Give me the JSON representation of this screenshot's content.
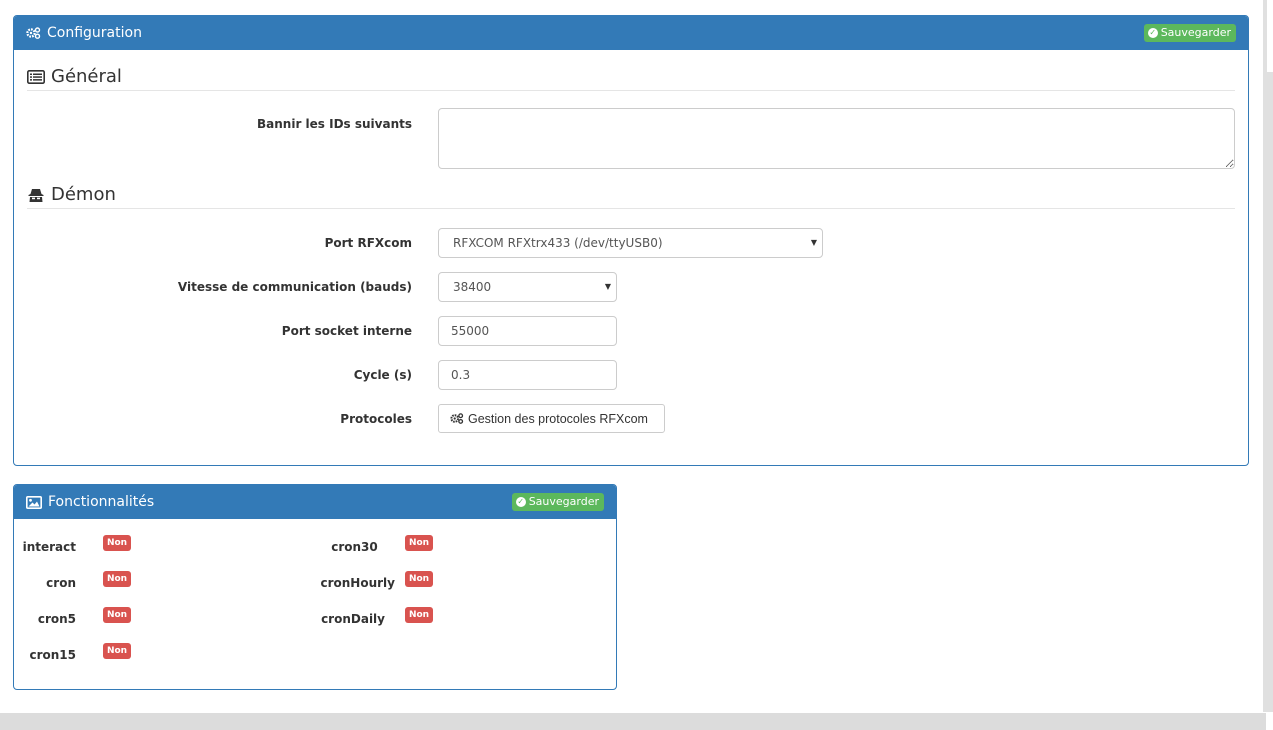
{
  "configuration": {
    "title": "Configuration",
    "save_label": "Sauvegarder",
    "general": {
      "legend": "Général",
      "ban_ids_label": "Bannir les IDs suivants",
      "ban_ids_value": ""
    },
    "daemon": {
      "legend": "Démon",
      "port_label": "Port RFXcom",
      "port_value": "RFXCOM RFXtrx433 (/dev/ttyUSB0)",
      "speed_label": "Vitesse de communication (bauds)",
      "speed_value": "38400",
      "socket_label": "Port socket interne",
      "socket_value": "55000",
      "cycle_label": "Cycle (s)",
      "cycle_value": "0.3",
      "protocols_label": "Protocoles",
      "protocols_button": "Gestion des protocoles RFXcom"
    }
  },
  "features": {
    "title": "Fonctionnalités",
    "save_label": "Sauvegarder",
    "items": [
      {
        "name": "interact",
        "status": "Non"
      },
      {
        "name": "cron",
        "status": "Non"
      },
      {
        "name": "cron5",
        "status": "Non"
      },
      {
        "name": "cron15",
        "status": "Non"
      },
      {
        "name": "cron30",
        "status": "Non"
      },
      {
        "name": "cronHourly",
        "status": "Non"
      },
      {
        "name": "cronDaily",
        "status": "Non"
      }
    ]
  },
  "colors": {
    "primary": "#337ab7",
    "success": "#5cb85c",
    "danger": "#d9534f"
  }
}
